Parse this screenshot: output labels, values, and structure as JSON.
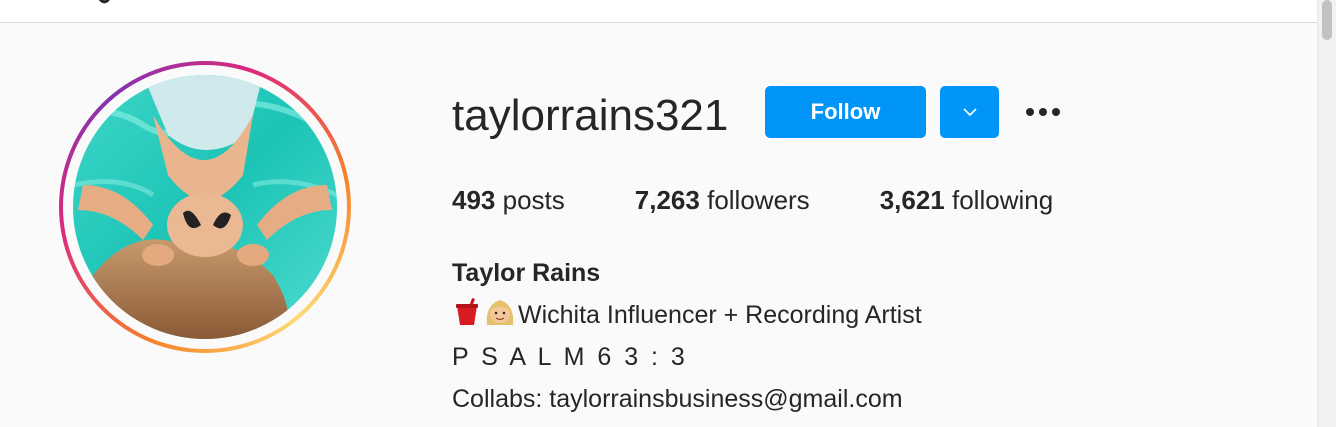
{
  "profile": {
    "username": "taylorrains321",
    "follow_label": "Follow",
    "dropdown_icon": "chevron-down-icon",
    "more_icon": "ellipsis-icon",
    "stats": {
      "posts_count": "493",
      "posts_label": "posts",
      "followers_count": "7,263",
      "followers_label": "followers",
      "following_count": "3,621",
      "following_label": "following"
    },
    "bio": {
      "name": "Taylor Rains",
      "line1_text": "Wichita Influencer + Recording Artist",
      "line1_emojis": [
        "cup-with-straw-emoji",
        "blonde-woman-emoji"
      ],
      "line2": "P S A L M 6 3 : 3",
      "line3": "Collabs: taylorrainsbusiness@gmail.com"
    },
    "avatar_icon": "profile-photo",
    "story_ring_colors": [
      "#f58529",
      "#dd2a7b",
      "#8134af"
    ]
  },
  "colors": {
    "button_blue": "#0095f6",
    "text_primary": "#262626",
    "background": "#fafafa"
  }
}
